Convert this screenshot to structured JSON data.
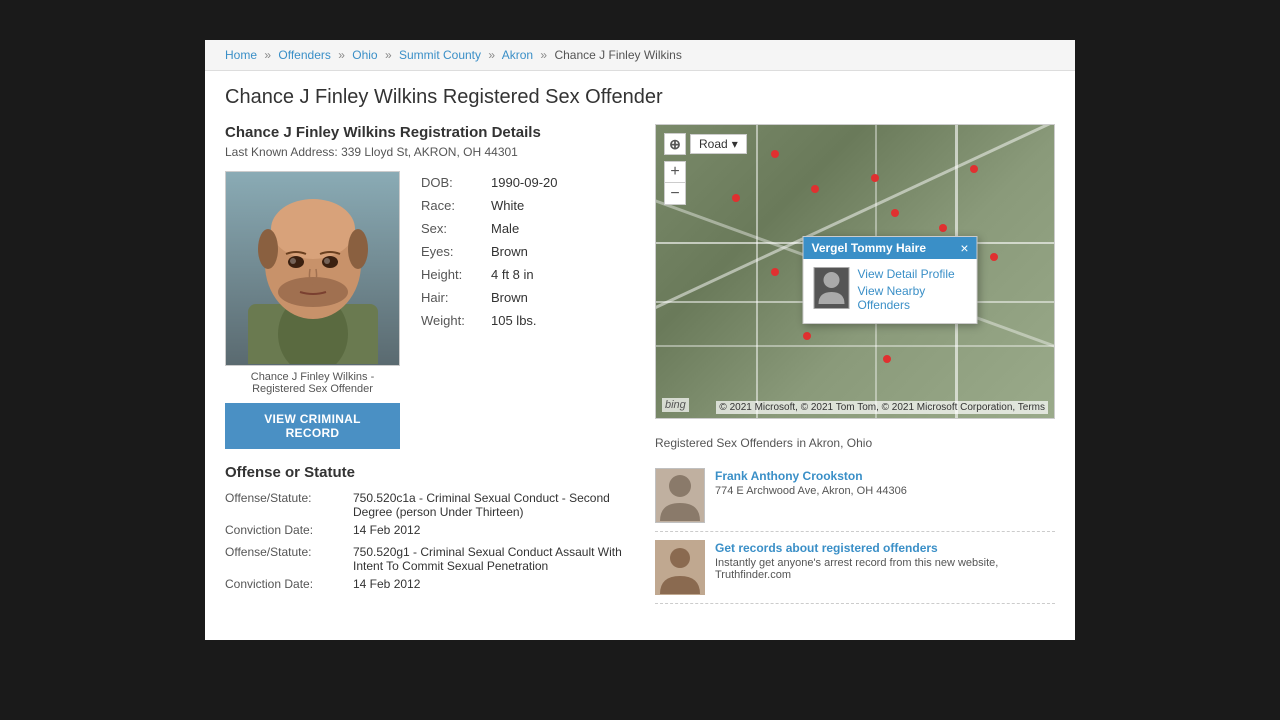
{
  "page": {
    "title": "Chance J Finley Wilkins Registered Sex Offender"
  },
  "breadcrumb": {
    "items": [
      {
        "label": "Home",
        "href": "#"
      },
      {
        "label": "Offenders",
        "href": "#"
      },
      {
        "label": "Ohio",
        "href": "#"
      },
      {
        "label": "Summit County",
        "href": "#"
      },
      {
        "label": "Akron",
        "href": "#"
      },
      {
        "label": "Chance J Finley Wilkins",
        "href": "#",
        "current": true
      }
    ]
  },
  "registration": {
    "heading": "Chance J Finley Wilkins Registration Details",
    "address_label": "Last Known Address:",
    "address": "339 Lloyd St, AKRON, OH 44301",
    "photo_caption": "Chance J Finley Wilkins - Registered Sex Offender",
    "view_record_btn": "VIEW CRIMINAL RECORD",
    "details": [
      {
        "label": "DOB:",
        "value": "1990-09-20"
      },
      {
        "label": "Race:",
        "value": "White"
      },
      {
        "label": "Sex:",
        "value": "Male"
      },
      {
        "label": "Eyes:",
        "value": "Brown"
      },
      {
        "label": "Height:",
        "value": "4 ft 8 in"
      },
      {
        "label": "Hair:",
        "value": "Brown"
      },
      {
        "label": "Weight:",
        "value": "105 lbs."
      }
    ]
  },
  "offense": {
    "heading": "Offense or Statute",
    "entries": [
      {
        "offense_label": "Offense/Statute:",
        "offense_value": "750.520c1a - Criminal Sexual Conduct - Second Degree (person Under Thirteen)",
        "conviction_label": "Conviction Date:",
        "conviction_value": "14 Feb 2012"
      },
      {
        "offense_label": "Offense/Statute:",
        "offense_value": "750.520g1 - Criminal Sexual Conduct Assault With Intent To Commit Sexual Penetration",
        "conviction_label": "Conviction Date:",
        "conviction_value": "14 Feb 2012"
      }
    ]
  },
  "map": {
    "road_btn": "Road",
    "popup": {
      "name": "Vergel Tommy Haire",
      "view_profile": "View Detail Profile",
      "view_nearby": "View Nearby Offenders",
      "close": "×"
    },
    "copyright": "© 2021 Microsoft, © 2021 Tom Tom, © 2021 Microsoft Corporation, Terms"
  },
  "offenders_sidebar": {
    "heading": "Registered Sex Offenders",
    "location": "in Akron, Ohio",
    "items": [
      {
        "name": "Frank Anthony Crookston",
        "address": "774 E Archwood Ave, Akron, OH 44306"
      }
    ],
    "ad": {
      "headline": "Get records about registered offenders",
      "body": "Instantly get anyone's arrest record from this new website, Truthfinder.com"
    }
  }
}
